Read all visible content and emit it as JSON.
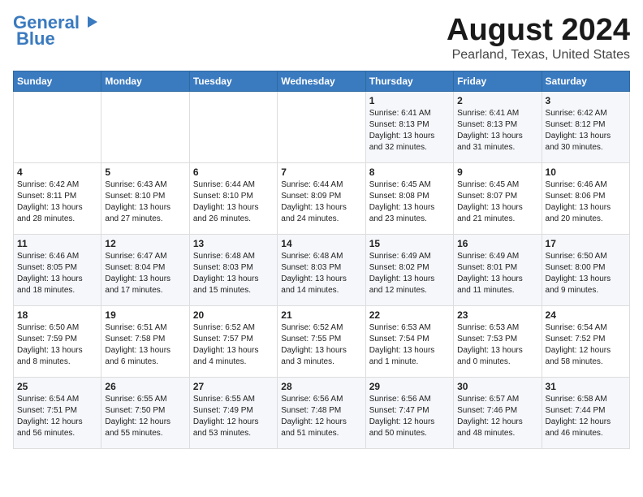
{
  "header": {
    "logo_line1": "General",
    "logo_line2": "Blue",
    "month": "August 2024",
    "location": "Pearland, Texas, United States"
  },
  "days_of_week": [
    "Sunday",
    "Monday",
    "Tuesday",
    "Wednesday",
    "Thursday",
    "Friday",
    "Saturday"
  ],
  "weeks": [
    [
      {
        "day": "",
        "info": ""
      },
      {
        "day": "",
        "info": ""
      },
      {
        "day": "",
        "info": ""
      },
      {
        "day": "",
        "info": ""
      },
      {
        "day": "1",
        "info": "Sunrise: 6:41 AM\nSunset: 8:13 PM\nDaylight: 13 hours\nand 32 minutes."
      },
      {
        "day": "2",
        "info": "Sunrise: 6:41 AM\nSunset: 8:13 PM\nDaylight: 13 hours\nand 31 minutes."
      },
      {
        "day": "3",
        "info": "Sunrise: 6:42 AM\nSunset: 8:12 PM\nDaylight: 13 hours\nand 30 minutes."
      }
    ],
    [
      {
        "day": "4",
        "info": "Sunrise: 6:42 AM\nSunset: 8:11 PM\nDaylight: 13 hours\nand 28 minutes."
      },
      {
        "day": "5",
        "info": "Sunrise: 6:43 AM\nSunset: 8:10 PM\nDaylight: 13 hours\nand 27 minutes."
      },
      {
        "day": "6",
        "info": "Sunrise: 6:44 AM\nSunset: 8:10 PM\nDaylight: 13 hours\nand 26 minutes."
      },
      {
        "day": "7",
        "info": "Sunrise: 6:44 AM\nSunset: 8:09 PM\nDaylight: 13 hours\nand 24 minutes."
      },
      {
        "day": "8",
        "info": "Sunrise: 6:45 AM\nSunset: 8:08 PM\nDaylight: 13 hours\nand 23 minutes."
      },
      {
        "day": "9",
        "info": "Sunrise: 6:45 AM\nSunset: 8:07 PM\nDaylight: 13 hours\nand 21 minutes."
      },
      {
        "day": "10",
        "info": "Sunrise: 6:46 AM\nSunset: 8:06 PM\nDaylight: 13 hours\nand 20 minutes."
      }
    ],
    [
      {
        "day": "11",
        "info": "Sunrise: 6:46 AM\nSunset: 8:05 PM\nDaylight: 13 hours\nand 18 minutes."
      },
      {
        "day": "12",
        "info": "Sunrise: 6:47 AM\nSunset: 8:04 PM\nDaylight: 13 hours\nand 17 minutes."
      },
      {
        "day": "13",
        "info": "Sunrise: 6:48 AM\nSunset: 8:03 PM\nDaylight: 13 hours\nand 15 minutes."
      },
      {
        "day": "14",
        "info": "Sunrise: 6:48 AM\nSunset: 8:03 PM\nDaylight: 13 hours\nand 14 minutes."
      },
      {
        "day": "15",
        "info": "Sunrise: 6:49 AM\nSunset: 8:02 PM\nDaylight: 13 hours\nand 12 minutes."
      },
      {
        "day": "16",
        "info": "Sunrise: 6:49 AM\nSunset: 8:01 PM\nDaylight: 13 hours\nand 11 minutes."
      },
      {
        "day": "17",
        "info": "Sunrise: 6:50 AM\nSunset: 8:00 PM\nDaylight: 13 hours\nand 9 minutes."
      }
    ],
    [
      {
        "day": "18",
        "info": "Sunrise: 6:50 AM\nSunset: 7:59 PM\nDaylight: 13 hours\nand 8 minutes."
      },
      {
        "day": "19",
        "info": "Sunrise: 6:51 AM\nSunset: 7:58 PM\nDaylight: 13 hours\nand 6 minutes."
      },
      {
        "day": "20",
        "info": "Sunrise: 6:52 AM\nSunset: 7:57 PM\nDaylight: 13 hours\nand 4 minutes."
      },
      {
        "day": "21",
        "info": "Sunrise: 6:52 AM\nSunset: 7:55 PM\nDaylight: 13 hours\nand 3 minutes."
      },
      {
        "day": "22",
        "info": "Sunrise: 6:53 AM\nSunset: 7:54 PM\nDaylight: 13 hours\nand 1 minute."
      },
      {
        "day": "23",
        "info": "Sunrise: 6:53 AM\nSunset: 7:53 PM\nDaylight: 13 hours\nand 0 minutes."
      },
      {
        "day": "24",
        "info": "Sunrise: 6:54 AM\nSunset: 7:52 PM\nDaylight: 12 hours\nand 58 minutes."
      }
    ],
    [
      {
        "day": "25",
        "info": "Sunrise: 6:54 AM\nSunset: 7:51 PM\nDaylight: 12 hours\nand 56 minutes."
      },
      {
        "day": "26",
        "info": "Sunrise: 6:55 AM\nSunset: 7:50 PM\nDaylight: 12 hours\nand 55 minutes."
      },
      {
        "day": "27",
        "info": "Sunrise: 6:55 AM\nSunset: 7:49 PM\nDaylight: 12 hours\nand 53 minutes."
      },
      {
        "day": "28",
        "info": "Sunrise: 6:56 AM\nSunset: 7:48 PM\nDaylight: 12 hours\nand 51 minutes."
      },
      {
        "day": "29",
        "info": "Sunrise: 6:56 AM\nSunset: 7:47 PM\nDaylight: 12 hours\nand 50 minutes."
      },
      {
        "day": "30",
        "info": "Sunrise: 6:57 AM\nSunset: 7:46 PM\nDaylight: 12 hours\nand 48 minutes."
      },
      {
        "day": "31",
        "info": "Sunrise: 6:58 AM\nSunset: 7:44 PM\nDaylight: 12 hours\nand 46 minutes."
      }
    ]
  ]
}
